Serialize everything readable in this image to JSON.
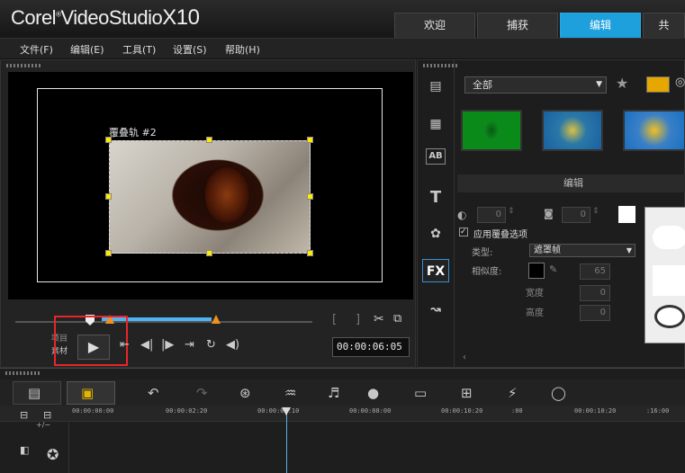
{
  "app": {
    "title_main": "Corel",
    "title_product": "VideoStudio",
    "title_version": "X10"
  },
  "tabs": [
    {
      "label": "欢迎"
    },
    {
      "label": "捕获"
    },
    {
      "label": "编辑",
      "active": true
    },
    {
      "label": "共"
    }
  ],
  "menu": [
    {
      "label": "文件(F)"
    },
    {
      "label": "编辑(E)"
    },
    {
      "label": "工具(T)"
    },
    {
      "label": "设置(S)"
    },
    {
      "label": "帮助(H)"
    }
  ],
  "preview": {
    "overlay_label": "覆叠轨 #2",
    "mode_project": "项目",
    "mode_clip": "素材",
    "timecode": "00:00:06:05",
    "play_icon": "▶",
    "controls": [
      "⇤",
      "◀|",
      "|▶",
      "⇥",
      "↻",
      "◀)"
    ]
  },
  "right": {
    "category": "全部",
    "section_title": "编辑",
    "apply_overlay": "应用覆叠选项",
    "type_label": "类型:",
    "type_value": "遮罩帧",
    "similarity_label": "相似度:",
    "similarity_value": "65",
    "width_label": "宽度",
    "width_value": "0",
    "height_label": "高度",
    "height_value": "0",
    "border_value": "0",
    "shadow_value": "0",
    "fx_label": "FX",
    "title_icon": "T",
    "ab_icon": "AB"
  },
  "timeline": {
    "ticks": [
      "00:00:00:00",
      "00:00:02:20",
      "00:00:0?:10",
      "00:00:08:00",
      "00:00:10:20",
      ":00",
      "00:00:10:20",
      ":16:00"
    ]
  },
  "colors": {
    "accent": "#1ea0dc",
    "highlight": "#e8262a",
    "handle": "#ffea00",
    "trim": "#4fb3f0"
  }
}
